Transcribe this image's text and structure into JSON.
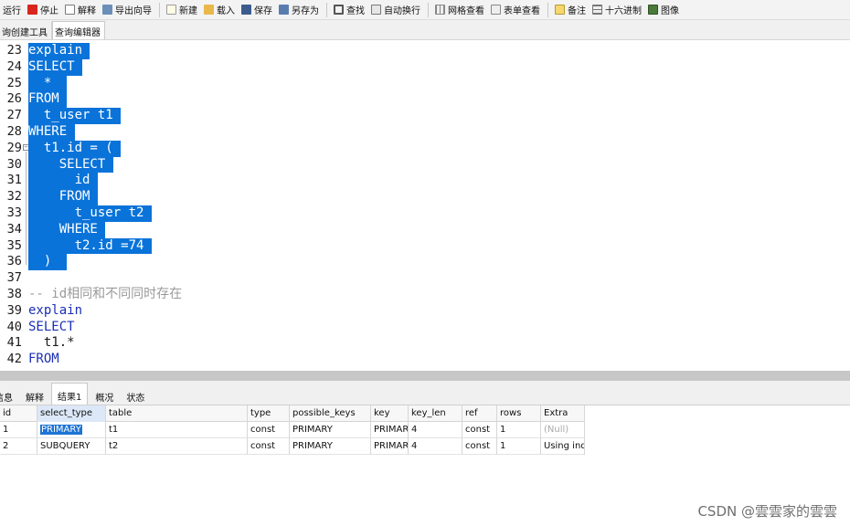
{
  "toolbar": {
    "run": "运行",
    "stop": "停止",
    "explain": "解释",
    "export_wizard": "导出向导",
    "new": "新建",
    "load": "载入",
    "save": "保存",
    "save_as": "另存为",
    "find": "查找",
    "word_wrap": "自动换行",
    "grid_view": "网格查看",
    "form_view": "表单查看",
    "memo": "备注",
    "hex": "十六进制",
    "image": "图像"
  },
  "editor_tabs": [
    "询创建工具",
    "查询编辑器"
  ],
  "editor_lines": [
    {
      "num": "23",
      "text": "explain",
      "selected": true,
      "cls": "kw"
    },
    {
      "num": "24",
      "text": "SELECT",
      "selected": true,
      "cls": "kw"
    },
    {
      "num": "25",
      "text": "  * ",
      "selected": true,
      "cls": ""
    },
    {
      "num": "26",
      "text": "FROM",
      "selected": true,
      "cls": "kw"
    },
    {
      "num": "27",
      "text": "  t_user t1",
      "selected": true,
      "cls": ""
    },
    {
      "num": "28",
      "text": "WHERE",
      "selected": true,
      "cls": "kw"
    },
    {
      "num": "29",
      "text": "  t1.id = (",
      "selected": true,
      "cls": "",
      "fold": true
    },
    {
      "num": "30",
      "text": "    SELECT",
      "selected": true,
      "cls": "kw"
    },
    {
      "num": "31",
      "text": "      id",
      "selected": true,
      "cls": ""
    },
    {
      "num": "32",
      "text": "    FROM",
      "selected": true,
      "cls": "kw"
    },
    {
      "num": "33",
      "text": "      t_user t2",
      "selected": true,
      "cls": ""
    },
    {
      "num": "34",
      "text": "    WHERE",
      "selected": true,
      "cls": "kw"
    },
    {
      "num": "35",
      "text": "      t2.id =74",
      "selected": true,
      "cls": ""
    },
    {
      "num": "36",
      "text": "  ) ",
      "selected": true,
      "cls": ""
    },
    {
      "num": "37",
      "text": "",
      "selected": false,
      "cls": ""
    },
    {
      "num": "38",
      "text": "-- id相同和不同同时存在",
      "selected": false,
      "cls": "cm"
    },
    {
      "num": "39",
      "text": "explain",
      "selected": false,
      "cls": "kw"
    },
    {
      "num": "40",
      "text": "SELECT",
      "selected": false,
      "cls": "kw"
    },
    {
      "num": "41",
      "text": "  t1.*",
      "selected": false,
      "cls": ""
    },
    {
      "num": "42",
      "text": "FROM",
      "selected": false,
      "cls": "kw"
    }
  ],
  "result_tabs": [
    "信息",
    "解释",
    "结果1",
    "概况",
    "状态"
  ],
  "result_tab_active": 2,
  "grid": {
    "columns": [
      "id",
      "select_type",
      "table",
      "type",
      "possible_keys",
      "key",
      "key_len",
      "ref",
      "rows",
      "Extra"
    ],
    "rows": [
      [
        "1",
        "PRIMARY",
        "t1",
        "const",
        "PRIMARY",
        "PRIMAR",
        "4",
        "const",
        "1",
        "(Null)"
      ],
      [
        "2",
        "SUBQUERY",
        "t2",
        "const",
        "PRIMARY",
        "PRIMAR",
        "4",
        "const",
        "1",
        "Using ind"
      ]
    ]
  },
  "watermark": "CSDN @雲雲家的雲雲"
}
